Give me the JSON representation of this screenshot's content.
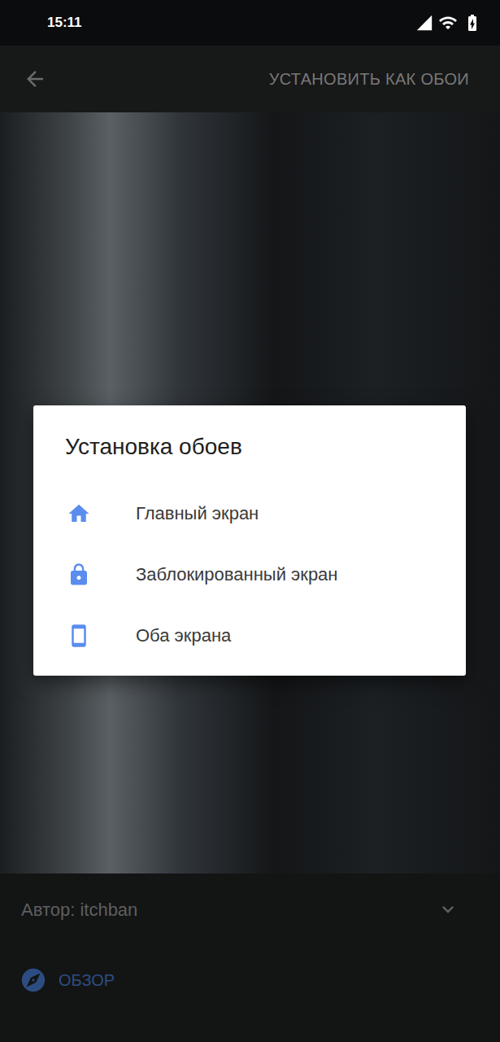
{
  "status_bar": {
    "time": "15:11"
  },
  "toolbar": {
    "action": "УСТАНОВИТЬ КАК ОБОИ"
  },
  "dialog": {
    "title": "Установка обоев",
    "options": [
      {
        "label": "Главный экран",
        "kind": "home"
      },
      {
        "label": "Заблокированный экран",
        "kind": "lock"
      },
      {
        "label": "Оба экрана",
        "kind": "both"
      }
    ]
  },
  "bottom_panel": {
    "author": "Автор: itchban",
    "explore": "ОБЗОР"
  }
}
